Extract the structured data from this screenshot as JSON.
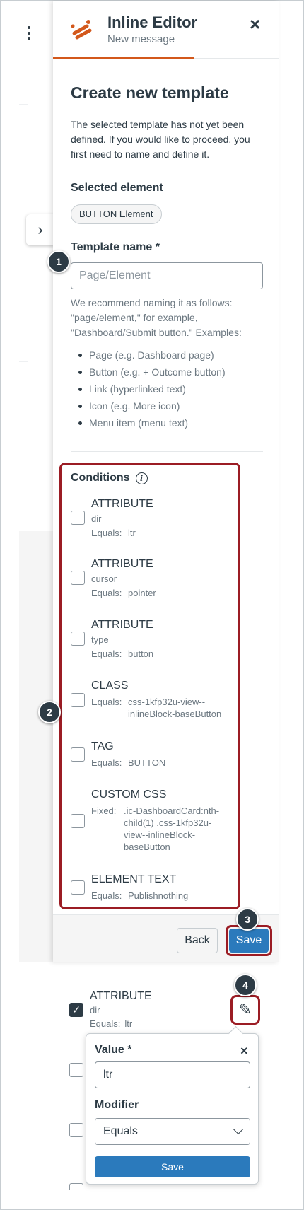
{
  "header": {
    "title": "Inline Editor",
    "subtitle": "New message",
    "close_icon": "×"
  },
  "form": {
    "heading": "Create new template",
    "intro": "The selected template has not yet been defined. If you would like to proceed, you first need to name and define it.",
    "selected_label": "Selected element",
    "selected_chip": "BUTTON Element",
    "template_name_label": "Template name *",
    "template_name_placeholder": "Page/Element",
    "recommend_text": "We recommend naming it as follows: \"page/element,\" for example, \"Dashboard/Submit button.\" Examples:",
    "examples": [
      "Page (e.g. Dashboard page)",
      "Button (e.g. + Outcome button)",
      "Link (hyperlinked text)",
      "Icon (e.g. More icon)",
      "Menu item (menu text)"
    ]
  },
  "conditions": {
    "title": "Conditions",
    "info_icon": "i",
    "items": [
      {
        "name": "ATTRIBUTE",
        "attr": "dir",
        "key": "Equals:",
        "value": "ltr"
      },
      {
        "name": "ATTRIBUTE",
        "attr": "cursor",
        "key": "Equals:",
        "value": "pointer"
      },
      {
        "name": "ATTRIBUTE",
        "attr": "type",
        "key": "Equals:",
        "value": "button"
      },
      {
        "name": "CLASS",
        "attr": "",
        "key": "Equals:",
        "value": "css-1kfp32u-view--inlineBlock-baseButton"
      },
      {
        "name": "TAG",
        "attr": "",
        "key": "Equals:",
        "value": "BUTTON"
      },
      {
        "name": "CUSTOM CSS",
        "attr": "",
        "key": "Fixed:",
        "value": ".ic-DashboardCard:nth-child(1) .css-1kfp32u-view--inlineBlock-baseButton"
      },
      {
        "name": "ELEMENT TEXT",
        "attr": "",
        "key": "Equals:",
        "value": "Publishnothing"
      }
    ]
  },
  "footer": {
    "back_label": "Back",
    "save_label": "Save"
  },
  "callouts": [
    "1",
    "2",
    "3",
    "4"
  ],
  "inset": {
    "item_name": "ATTRIBUTE",
    "item_attr": "dir",
    "item_key": "Equals:",
    "item_value": "ltr",
    "value_label": "Value *",
    "value_input": "ltr",
    "modifier_label": "Modifier",
    "modifier_selected": "Equals",
    "save_label": "Save",
    "close_icon": "×",
    "pencil_icon": "✎",
    "check_icon": "✓"
  },
  "background": {
    "expand_icon": "›"
  },
  "colors": {
    "accent_orange": "#d3581b",
    "primary_blue": "#2b7abc",
    "highlight_red": "#9b1c24",
    "text_dark": "#2d3b45",
    "text_muted": "#6b7780"
  }
}
